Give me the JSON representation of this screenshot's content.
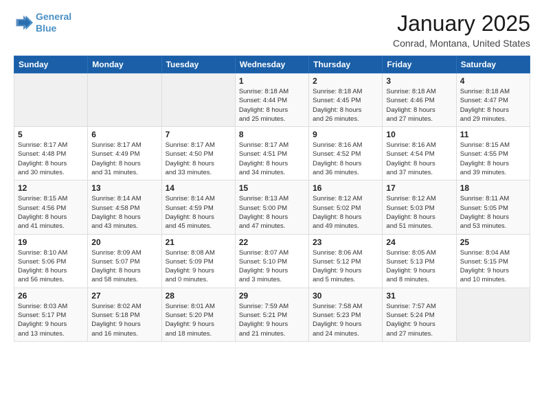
{
  "header": {
    "logo_line1": "General",
    "logo_line2": "Blue",
    "month": "January 2025",
    "location": "Conrad, Montana, United States"
  },
  "weekdays": [
    "Sunday",
    "Monday",
    "Tuesday",
    "Wednesday",
    "Thursday",
    "Friday",
    "Saturday"
  ],
  "weeks": [
    [
      {
        "day": "",
        "info": ""
      },
      {
        "day": "",
        "info": ""
      },
      {
        "day": "",
        "info": ""
      },
      {
        "day": "1",
        "info": "Sunrise: 8:18 AM\nSunset: 4:44 PM\nDaylight: 8 hours\nand 25 minutes."
      },
      {
        "day": "2",
        "info": "Sunrise: 8:18 AM\nSunset: 4:45 PM\nDaylight: 8 hours\nand 26 minutes."
      },
      {
        "day": "3",
        "info": "Sunrise: 8:18 AM\nSunset: 4:46 PM\nDaylight: 8 hours\nand 27 minutes."
      },
      {
        "day": "4",
        "info": "Sunrise: 8:18 AM\nSunset: 4:47 PM\nDaylight: 8 hours\nand 29 minutes."
      }
    ],
    [
      {
        "day": "5",
        "info": "Sunrise: 8:17 AM\nSunset: 4:48 PM\nDaylight: 8 hours\nand 30 minutes."
      },
      {
        "day": "6",
        "info": "Sunrise: 8:17 AM\nSunset: 4:49 PM\nDaylight: 8 hours\nand 31 minutes."
      },
      {
        "day": "7",
        "info": "Sunrise: 8:17 AM\nSunset: 4:50 PM\nDaylight: 8 hours\nand 33 minutes."
      },
      {
        "day": "8",
        "info": "Sunrise: 8:17 AM\nSunset: 4:51 PM\nDaylight: 8 hours\nand 34 minutes."
      },
      {
        "day": "9",
        "info": "Sunrise: 8:16 AM\nSunset: 4:52 PM\nDaylight: 8 hours\nand 36 minutes."
      },
      {
        "day": "10",
        "info": "Sunrise: 8:16 AM\nSunset: 4:54 PM\nDaylight: 8 hours\nand 37 minutes."
      },
      {
        "day": "11",
        "info": "Sunrise: 8:15 AM\nSunset: 4:55 PM\nDaylight: 8 hours\nand 39 minutes."
      }
    ],
    [
      {
        "day": "12",
        "info": "Sunrise: 8:15 AM\nSunset: 4:56 PM\nDaylight: 8 hours\nand 41 minutes."
      },
      {
        "day": "13",
        "info": "Sunrise: 8:14 AM\nSunset: 4:58 PM\nDaylight: 8 hours\nand 43 minutes."
      },
      {
        "day": "14",
        "info": "Sunrise: 8:14 AM\nSunset: 4:59 PM\nDaylight: 8 hours\nand 45 minutes."
      },
      {
        "day": "15",
        "info": "Sunrise: 8:13 AM\nSunset: 5:00 PM\nDaylight: 8 hours\nand 47 minutes."
      },
      {
        "day": "16",
        "info": "Sunrise: 8:12 AM\nSunset: 5:02 PM\nDaylight: 8 hours\nand 49 minutes."
      },
      {
        "day": "17",
        "info": "Sunrise: 8:12 AM\nSunset: 5:03 PM\nDaylight: 8 hours\nand 51 minutes."
      },
      {
        "day": "18",
        "info": "Sunrise: 8:11 AM\nSunset: 5:05 PM\nDaylight: 8 hours\nand 53 minutes."
      }
    ],
    [
      {
        "day": "19",
        "info": "Sunrise: 8:10 AM\nSunset: 5:06 PM\nDaylight: 8 hours\nand 56 minutes."
      },
      {
        "day": "20",
        "info": "Sunrise: 8:09 AM\nSunset: 5:07 PM\nDaylight: 8 hours\nand 58 minutes."
      },
      {
        "day": "21",
        "info": "Sunrise: 8:08 AM\nSunset: 5:09 PM\nDaylight: 9 hours\nand 0 minutes."
      },
      {
        "day": "22",
        "info": "Sunrise: 8:07 AM\nSunset: 5:10 PM\nDaylight: 9 hours\nand 3 minutes."
      },
      {
        "day": "23",
        "info": "Sunrise: 8:06 AM\nSunset: 5:12 PM\nDaylight: 9 hours\nand 5 minutes."
      },
      {
        "day": "24",
        "info": "Sunrise: 8:05 AM\nSunset: 5:13 PM\nDaylight: 9 hours\nand 8 minutes."
      },
      {
        "day": "25",
        "info": "Sunrise: 8:04 AM\nSunset: 5:15 PM\nDaylight: 9 hours\nand 10 minutes."
      }
    ],
    [
      {
        "day": "26",
        "info": "Sunrise: 8:03 AM\nSunset: 5:17 PM\nDaylight: 9 hours\nand 13 minutes."
      },
      {
        "day": "27",
        "info": "Sunrise: 8:02 AM\nSunset: 5:18 PM\nDaylight: 9 hours\nand 16 minutes."
      },
      {
        "day": "28",
        "info": "Sunrise: 8:01 AM\nSunset: 5:20 PM\nDaylight: 9 hours\nand 18 minutes."
      },
      {
        "day": "29",
        "info": "Sunrise: 7:59 AM\nSunset: 5:21 PM\nDaylight: 9 hours\nand 21 minutes."
      },
      {
        "day": "30",
        "info": "Sunrise: 7:58 AM\nSunset: 5:23 PM\nDaylight: 9 hours\nand 24 minutes."
      },
      {
        "day": "31",
        "info": "Sunrise: 7:57 AM\nSunset: 5:24 PM\nDaylight: 9 hours\nand 27 minutes."
      },
      {
        "day": "",
        "info": ""
      }
    ]
  ]
}
